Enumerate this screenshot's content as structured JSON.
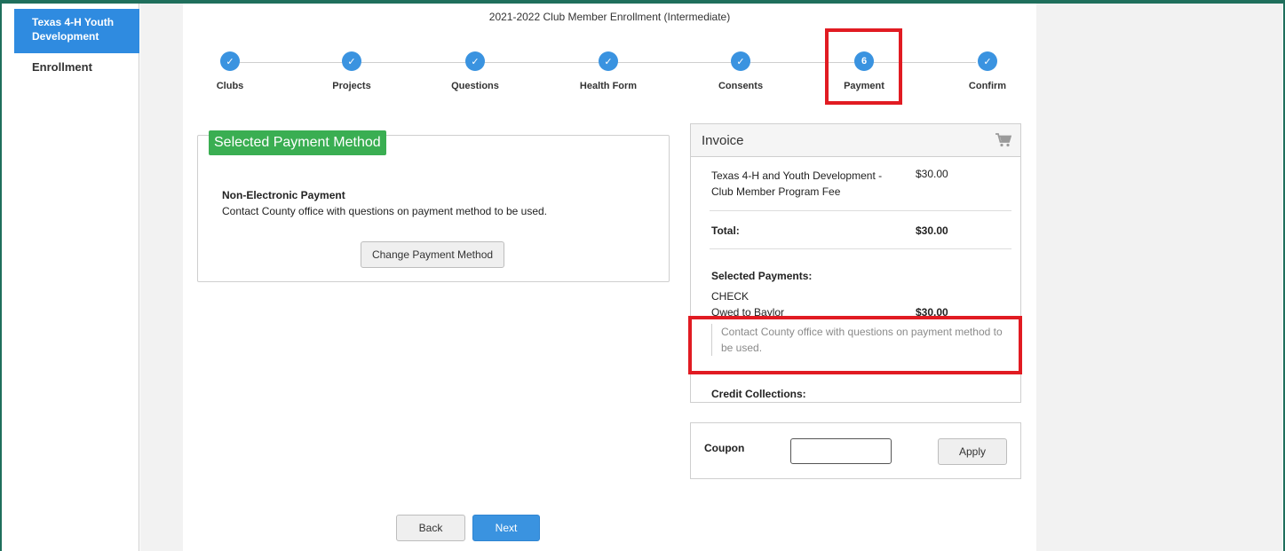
{
  "sidebar": {
    "active_item": "Texas 4-H Youth Development",
    "items": [
      {
        "label": "Enrollment"
      }
    ]
  },
  "page": {
    "title": "2021-2022 Club Member Enrollment (Intermediate)"
  },
  "stepper": {
    "steps": [
      {
        "label": "Clubs",
        "state": "complete",
        "marker": "✓"
      },
      {
        "label": "Projects",
        "state": "complete",
        "marker": "✓"
      },
      {
        "label": "Questions",
        "state": "complete",
        "marker": "✓"
      },
      {
        "label": "Health Form",
        "state": "complete",
        "marker": "✓"
      },
      {
        "label": "Consents",
        "state": "complete",
        "marker": "✓"
      },
      {
        "label": "Payment",
        "state": "current",
        "marker": "6"
      },
      {
        "label": "Confirm",
        "state": "complete",
        "marker": "✓"
      }
    ]
  },
  "payment_method": {
    "header": "Selected Payment Method",
    "title": "Non-Electronic Payment",
    "description": "Contact County office with questions on payment method to be used.",
    "change_button": "Change Payment Method"
  },
  "invoice": {
    "title": "Invoice",
    "cart_icon": "shopping-cart-icon",
    "line_item": {
      "description": "Texas 4-H and Youth Development - Club Member Program Fee",
      "amount": "$30.00"
    },
    "total_label": "Total:",
    "total_amount": "$30.00",
    "selected_payments_label": "Selected Payments:",
    "payment_type": "CHECK",
    "owed_label": "Owed to Baylor",
    "owed_amount": "$30.00",
    "note": "Contact County office with questions on payment method to be used.",
    "credit_label": "Credit Collections:"
  },
  "coupon": {
    "label": "Coupon",
    "value": "",
    "apply_button": "Apply"
  },
  "footer": {
    "back_button": "Back",
    "next_button": "Next"
  },
  "colors": {
    "accent_blue": "#3a93e0",
    "green_tag": "#3aae52",
    "highlight_red": "#e11b22",
    "frame_green": "#1f6f5c"
  }
}
